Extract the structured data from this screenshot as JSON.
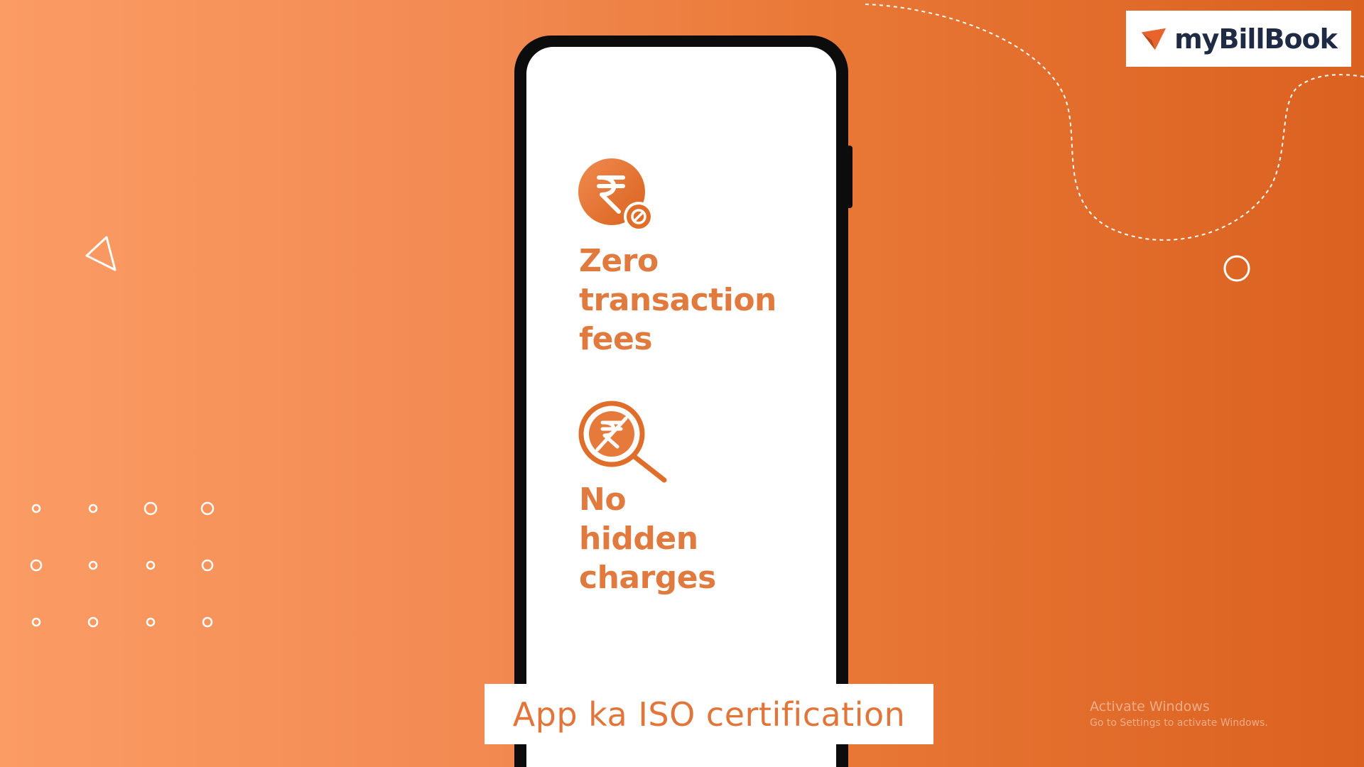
{
  "brand": {
    "logo_prefix": "my",
    "logo_name": "BillBook",
    "accent_color": "#e2753a",
    "logo_mark_color": "#e8642c"
  },
  "phone_screen": {
    "features": [
      {
        "icon": "rupee-no-fee-icon",
        "lines": [
          "Zero",
          "transaction",
          "fees"
        ]
      },
      {
        "icon": "rupee-magnifier-icon",
        "lines": [
          "No",
          "hidden",
          "charges"
        ]
      }
    ]
  },
  "caption": {
    "text": "App ka ISO certification"
  },
  "watermark": {
    "title": "Activate Windows",
    "subtitle": "Go to Settings to activate Windows."
  }
}
